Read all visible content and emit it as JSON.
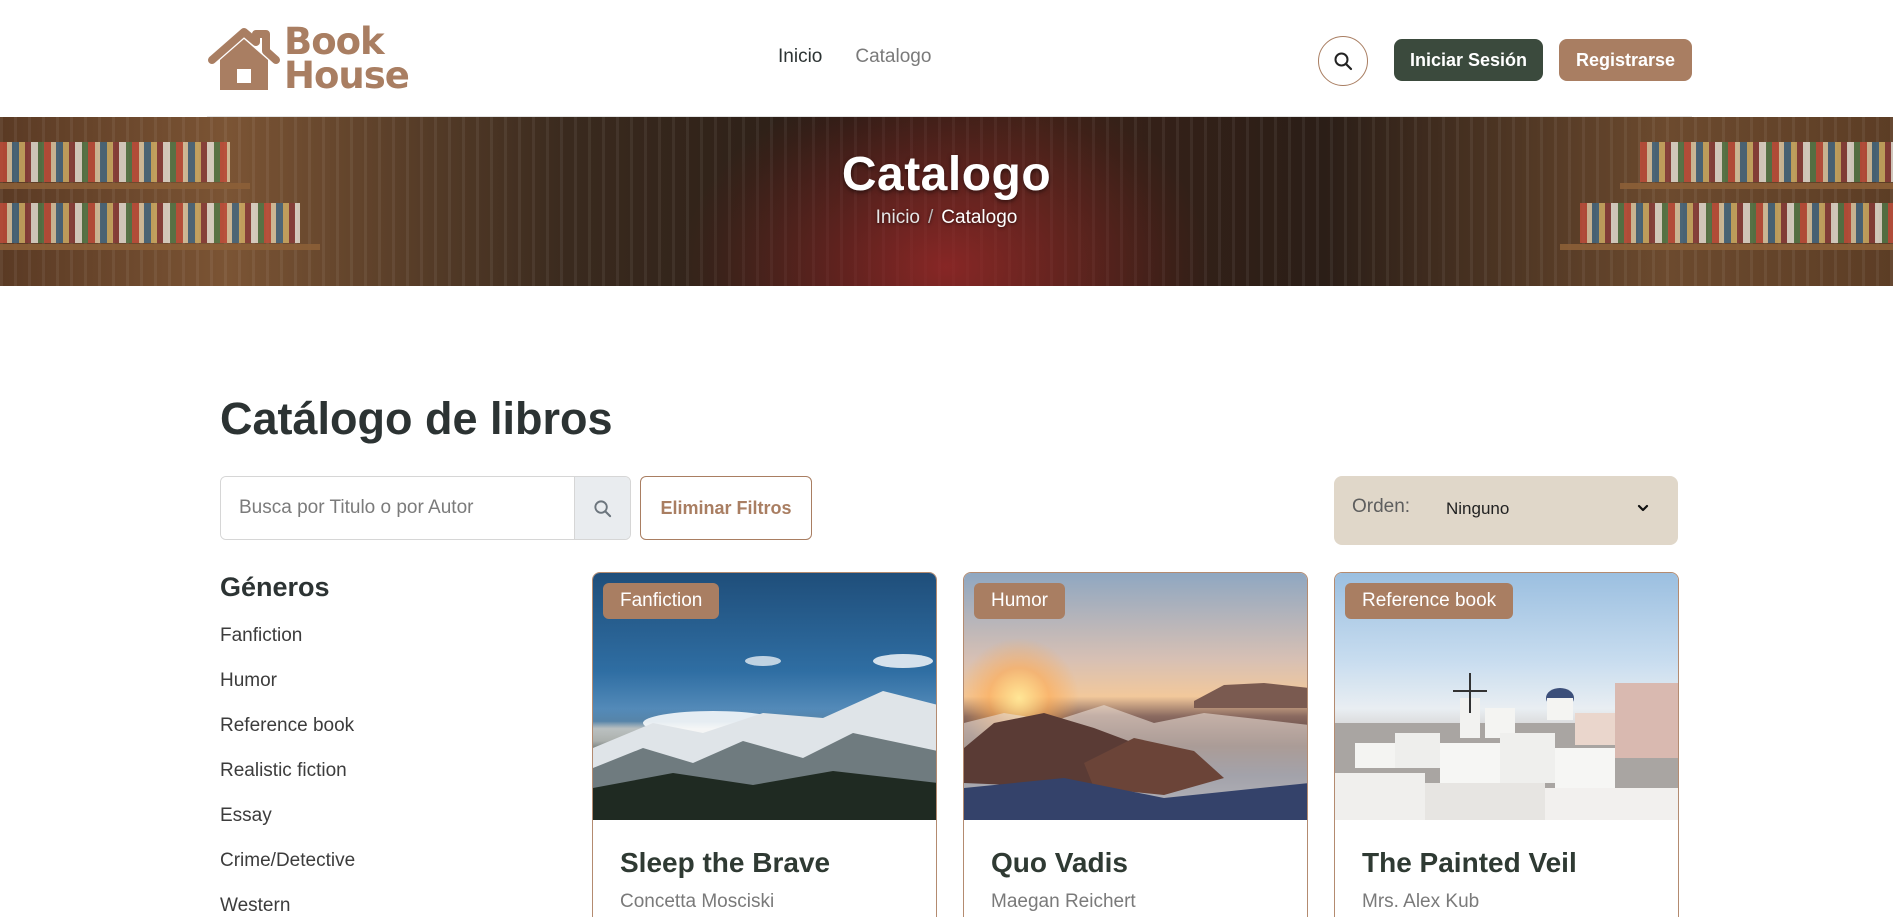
{
  "brand": {
    "line1": "Book",
    "line2": "House",
    "color": "#a97e62"
  },
  "nav": {
    "inicio": "Inicio",
    "catalogo": "Catalogo"
  },
  "header": {
    "search_icon": "search-icon",
    "login_label": "Iniciar Sesión",
    "register_label": "Registrarse"
  },
  "hero": {
    "title": "Catalogo",
    "breadcrumb_home": "Inicio",
    "breadcrumb_sep": "/",
    "breadcrumb_current": "Catalogo"
  },
  "main": {
    "title": "Catálogo de libros",
    "search_placeholder": "Busca por Titulo o por Autor",
    "clear_filters_label": "Eliminar Filtros",
    "sort_label": "Orden:",
    "sort_value": "Ninguno"
  },
  "genres": {
    "title": "Géneros",
    "items": [
      "Fanfiction",
      "Humor",
      "Reference book",
      "Realistic fiction",
      "Essay",
      "Crime/Detective",
      "Western"
    ]
  },
  "books": [
    {
      "genre": "Fanfiction",
      "title": "Sleep the Brave",
      "author": "Concetta Mosciski"
    },
    {
      "genre": "Humor",
      "title": "Quo Vadis",
      "author": "Maegan Reichert"
    },
    {
      "genre": "Reference book",
      "title": "The Painted Veil",
      "author": "Mrs. Alex Kub"
    }
  ],
  "colors": {
    "accent": "#a97e62",
    "dark_button": "#3b4a3d",
    "sort_bg": "#e0d7c9",
    "text": "#2c3333"
  }
}
